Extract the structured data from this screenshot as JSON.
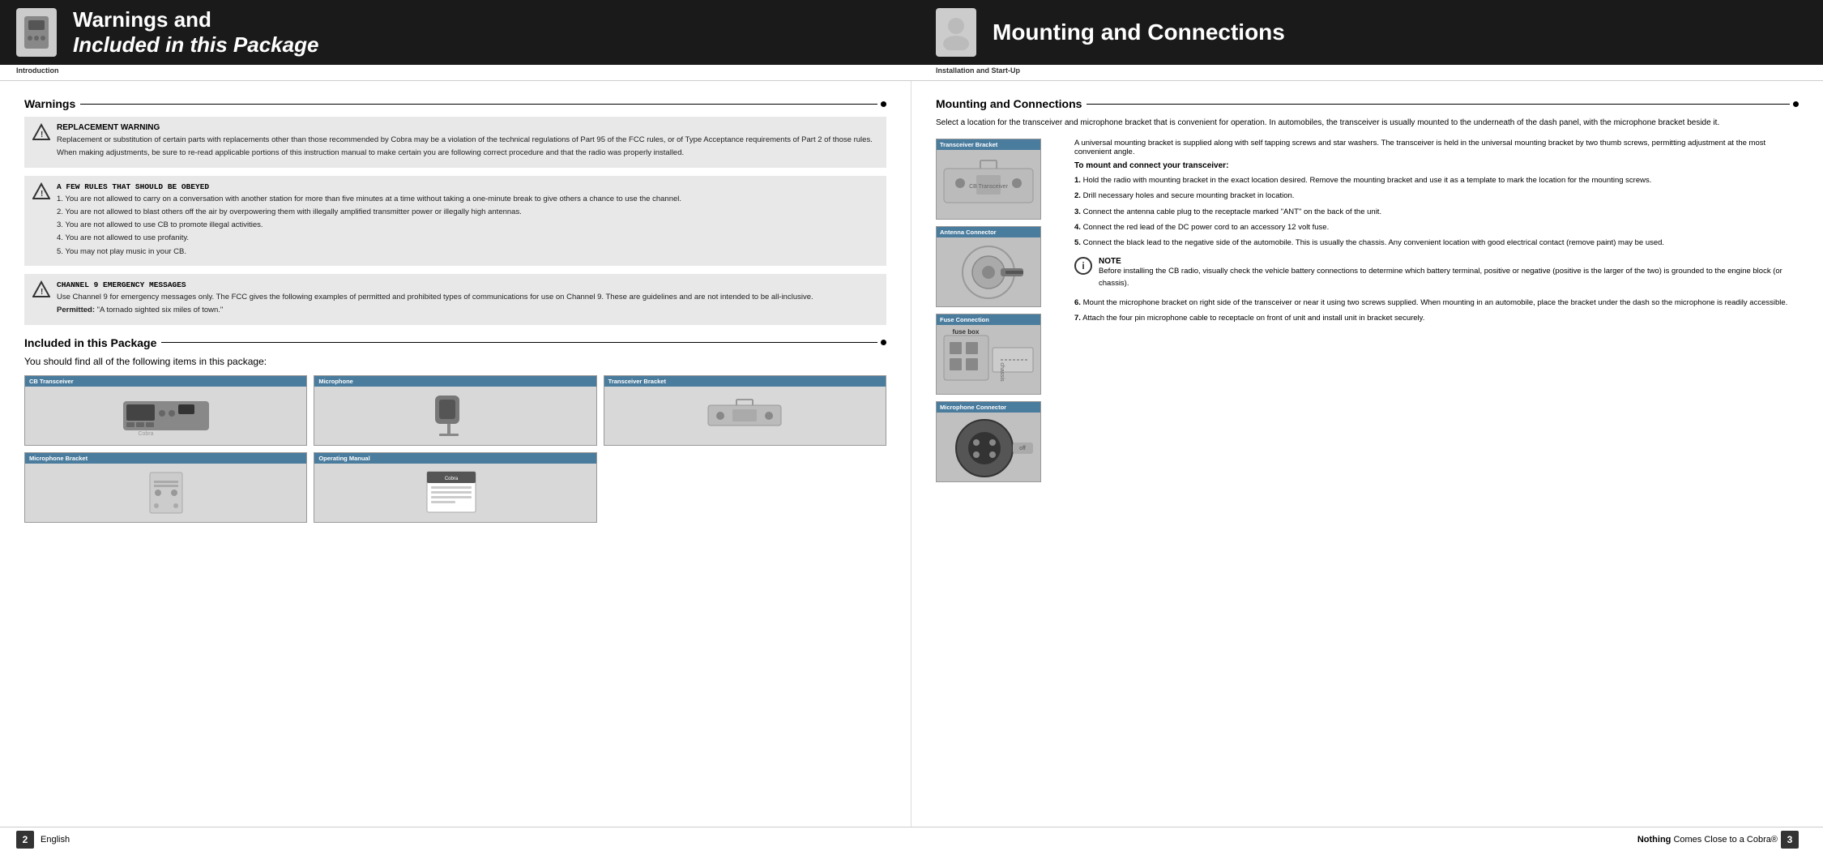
{
  "header": {
    "left": {
      "title_line1": "Warnings and",
      "title_line2": "Included in this Package",
      "section_label": "Introduction"
    },
    "right": {
      "title": "Mounting and Connections",
      "section_label": "Installation and Start-Up"
    }
  },
  "left_panel": {
    "warnings_heading": "Warnings",
    "warning1": {
      "title": "REPLACEMENT WARNING",
      "paragraphs": [
        "Replacement or substitution of certain parts with replacements other than those recommended by Cobra may be a violation of the technical regulations of Part 95 of the FCC rules, or of Type Acceptance requirements of Part 2 of those rules.",
        "When making adjustments, be sure to re-read applicable portions of this instruction manual to make certain you are following correct procedure and that the radio was properly installed."
      ]
    },
    "warning2": {
      "title": "A FEW RULES THAT SHOULD BE OBEYED",
      "items": [
        "1. You are not allowed to carry on a conversation with another station for more than five minutes at a time without taking a one-minute break to give others a chance to use the channel.",
        "2. You are not allowed to blast others off the air by overpowering them with illegally amplified transmitter power or illegally high antennas.",
        "3. You are not allowed to use CB to promote illegal activities.",
        "4. You are not allowed to use profanity.",
        "5. You may not play music in your CB."
      ]
    },
    "warning3": {
      "title": "CHANNEL 9 EMERGENCY MESSAGES",
      "body": "Use Channel 9 for emergency messages only. The FCC gives the following examples of permitted and prohibited types of communications for use on Channel 9. These are guidelines and are not intended to be all-inclusive.",
      "permitted_label": "Permitted:",
      "permitted": "\"A tornado sighted six miles of town.\""
    },
    "included_heading": "Included in this Package",
    "included_subtitle": "You should find all of the following items in this package:",
    "package_items": [
      {
        "label": "CB Transceiver",
        "id": "cb-transceiver"
      },
      {
        "label": "Microphone",
        "id": "microphone"
      },
      {
        "label": "Transceiver Bracket",
        "id": "transceiver-bracket"
      },
      {
        "label": "Microphone Bracket",
        "id": "microphone-bracket"
      },
      {
        "label": "Operating Manual",
        "id": "operating-manual"
      }
    ]
  },
  "right_panel": {
    "heading": "Mounting and Connections",
    "intro": "Select a location for the transceiver and microphone bracket that is convenient for operation. In automobiles, the transceiver is usually mounted to the underneath of the dash panel, with the microphone bracket beside it.",
    "universal_text": "A universal mounting bracket is supplied along with self tapping screws and star washers. The transceiver is held in the universal mounting bracket by two thumb screws, permitting adjustment at the most convenient angle.",
    "to_mount_label": "To mount and connect your transceiver:",
    "steps": [
      "Hold the radio with mounting bracket in the exact location desired. Remove the mounting bracket and use it as a template to mark the location for the mounting screws.",
      "Drill necessary holes and secure mounting bracket in location.",
      "Connect the antenna cable plug to the receptacle marked \"ANT\" on the back of the unit.",
      "Connect the red lead of the DC power cord to an accessory 12 volt fuse.",
      "Connect the black lead to the negative side of the automobile. This is usually the chassis. Any convenient location with good electrical contact (remove paint) may be used.",
      "Mount the microphone bracket on right side of the transceiver or near it using two screws supplied. When mounting in an automobile, place the bracket under the dash so the microphone is readily accessible.",
      "Attach the four pin microphone cable to receptacle on front of unit and install unit in bracket securely."
    ],
    "note_title": "NOTE",
    "note_text": "Before installing the CB radio, visually check the vehicle battery connections to determine which battery terminal, positive or negative (positive is the larger of the two) is grounded to the engine block (or chassis).",
    "connectors": [
      {
        "label": "Transceiver Bracket",
        "id": "trans-bracket"
      },
      {
        "label": "Antenna Connector",
        "id": "antenna-conn"
      },
      {
        "label": "Fuse Connection",
        "id": "fuse-conn"
      },
      {
        "label": "Microphone Connector",
        "id": "mic-conn"
      }
    ]
  },
  "footer": {
    "left": {
      "page_num": "2",
      "lang": "English"
    },
    "right": {
      "brand_prefix": "Nothing",
      "brand_middle": " Comes Close to a Cobra",
      "brand_suffix": "®",
      "page_num": "3"
    }
  }
}
